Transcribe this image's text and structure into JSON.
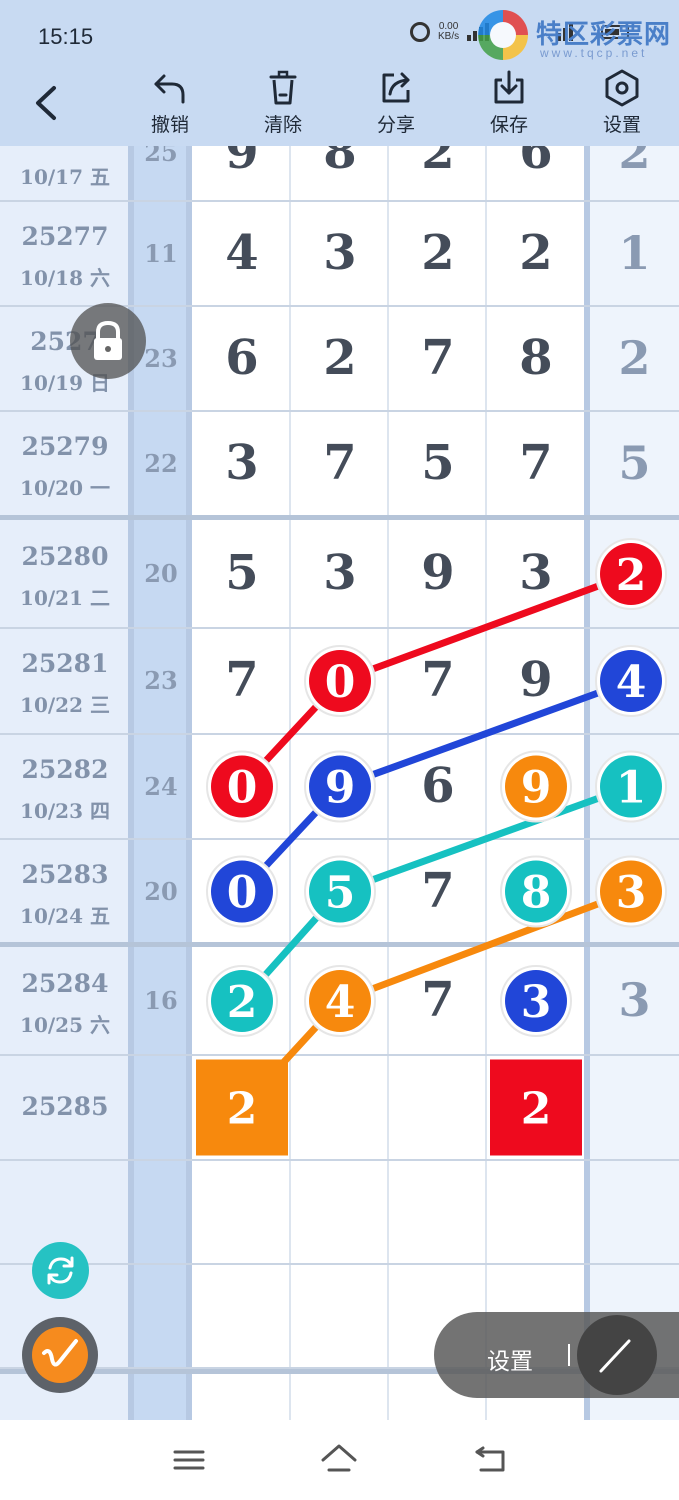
{
  "status_bar": {
    "time": "15:15",
    "net_speed_value": "0.00",
    "net_speed_unit": "KB/s",
    "icons": [
      "alarm-icon",
      "signal-icon",
      "wifi-icon",
      "battery-icon"
    ]
  },
  "watermark": {
    "text": "特区彩票网",
    "sub": "www.tqcp.net"
  },
  "toolbar": {
    "undo_label": "撤销",
    "clear_label": "清除",
    "share_label": "分享",
    "save_label": "保存",
    "settings_label": "设置"
  },
  "table": {
    "rows": [
      {
        "issue": "",
        "date": "10/17 五",
        "sum": "25",
        "digits": [
          "9",
          "8",
          "2",
          "6"
        ],
        "last": "2"
      },
      {
        "issue": "25277",
        "date": "10/18 六",
        "sum": "11",
        "digits": [
          "4",
          "3",
          "2",
          "2"
        ],
        "last": "1"
      },
      {
        "issue": "2527",
        "date": "10/19 日",
        "sum": "23",
        "digits": [
          "6",
          "2",
          "7",
          "8"
        ],
        "last": "2"
      },
      {
        "issue": "25279",
        "date": "10/20 一",
        "sum": "22",
        "digits": [
          "3",
          "7",
          "5",
          "7"
        ],
        "last": "5"
      },
      {
        "issue": "25280",
        "date": "10/21 二",
        "sum": "20",
        "digits": [
          "5",
          "3",
          "9",
          "3"
        ],
        "last": "2"
      },
      {
        "issue": "25281",
        "date": "10/22 三",
        "sum": "23",
        "digits": [
          "7",
          "0",
          "7",
          "9"
        ],
        "last": "4"
      },
      {
        "issue": "25282",
        "date": "10/23 四",
        "sum": "24",
        "digits": [
          "0",
          "9",
          "6",
          "9"
        ],
        "last": "1"
      },
      {
        "issue": "25283",
        "date": "10/24 五",
        "sum": "20",
        "digits": [
          "0",
          "5",
          "7",
          "8"
        ],
        "last": "3"
      },
      {
        "issue": "25284",
        "date": "10/25 六",
        "sum": "16",
        "digits": [
          "2",
          "4",
          "7",
          "3"
        ],
        "last": "3"
      },
      {
        "issue": "25285",
        "date": "",
        "sum": "",
        "digits": [
          "2",
          "",
          "",
          "2"
        ],
        "last": ""
      }
    ],
    "balls": [
      {
        "row": 4,
        "col": 4,
        "color": "red"
      },
      {
        "row": 5,
        "col": 1,
        "color": "red"
      },
      {
        "row": 6,
        "col": 0,
        "color": "red"
      },
      {
        "row": 5,
        "col": 4,
        "color": "blue"
      },
      {
        "row": 6,
        "col": 1,
        "color": "blue"
      },
      {
        "row": 7,
        "col": 0,
        "color": "blue"
      },
      {
        "row": 8,
        "col": 3,
        "color": "blue"
      },
      {
        "row": 6,
        "col": 3,
        "color": "orange"
      },
      {
        "row": 7,
        "col": 4,
        "color": "orange"
      },
      {
        "row": 8,
        "col": 1,
        "color": "orange"
      },
      {
        "row": 6,
        "col": 4,
        "color": "teal"
      },
      {
        "row": 7,
        "col": 1,
        "color": "teal"
      },
      {
        "row": 7,
        "col": 3,
        "color": "teal"
      },
      {
        "row": 8,
        "col": 0,
        "color": "teal"
      }
    ],
    "lines": [
      {
        "color": "red",
        "points": [
          [
            4,
            4
          ],
          [
            5,
            1
          ],
          [
            6,
            0
          ]
        ]
      },
      {
        "color": "blue",
        "points": [
          [
            5,
            4
          ],
          [
            6,
            1
          ],
          [
            7,
            0
          ]
        ]
      },
      {
        "color": "teal",
        "points": [
          [
            6,
            4
          ],
          [
            7,
            1
          ],
          [
            8,
            0
          ]
        ]
      },
      {
        "color": "orange",
        "points": [
          [
            7,
            4
          ],
          [
            8,
            1
          ],
          [
            9,
            0
          ]
        ]
      }
    ],
    "squares": [
      {
        "row": 9,
        "col": 0,
        "color": "orange"
      },
      {
        "row": 9,
        "col": 3,
        "color": "red"
      }
    ]
  },
  "colors": {
    "red": "#ee0a1e",
    "blue": "#2146d8",
    "orange": "#f7890d",
    "teal": "#16c1c1",
    "header_bg": "#c8daf2"
  },
  "float_bar": {
    "settings_label": "设置"
  }
}
